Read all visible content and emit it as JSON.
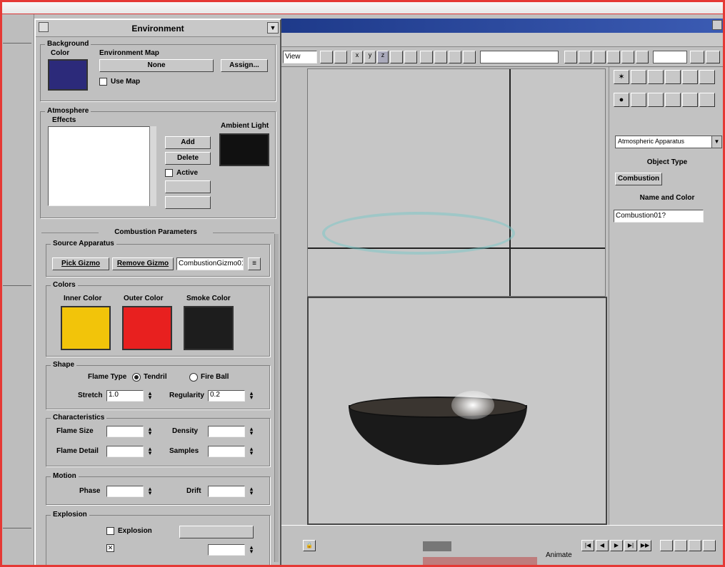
{
  "dialog": {
    "title": "Environment",
    "background": {
      "group": "Background",
      "color_label": "Color",
      "color_value": "#2c2a7a",
      "envmap_label": "Environment Map",
      "envmap_button": "None",
      "assign_button": "Assign...",
      "usemap_label": "Use Map"
    },
    "atmosphere": {
      "group": "Atmosphere",
      "effects_label": "Effects",
      "ambient_label": "Ambient Light",
      "ambient_value": "#111111",
      "add_button": "Add",
      "delete_button": "Delete",
      "active_label": "Active"
    },
    "combustion": {
      "rollout_title": "Combustion Parameters",
      "gizmos_group": "Source Apparatus",
      "pick_button": "Pick Gizmo",
      "remove_button": "Remove Gizmo",
      "gizmo_field": "CombustionGizmo01",
      "colors_group": "Colors",
      "inner_label": "Inner Color",
      "inner_value": "#f2c40a",
      "outer_label": "Outer Color",
      "outer_value": "#e8201f",
      "smoke_label": "Smoke Color",
      "smoke_value": "#1d1d1d",
      "shape_group": "Shape",
      "flame_type_label": "Flame Type",
      "tendril_label": "Tendril",
      "fireball_label": "Fire Ball",
      "stretch_label": "Stretch",
      "stretch_value": "1.0",
      "regularity_label": "Regularity",
      "regularity_value": "0.2",
      "characteristics_group": "Characteristics",
      "flame_size_label": "Flame Size",
      "flame_size_value": "",
      "density_label": "Density",
      "density_value": "",
      "flame_detail_label": "Flame Detail",
      "flame_detail_value": "",
      "samples_label": "Samples",
      "samples_value": "",
      "motion_group": "Motion",
      "phase_label": "Phase",
      "phase_value": "",
      "drift_label": "Drift",
      "drift_value": "",
      "explosion_group": "Explosion",
      "explosion_label": "Explosion"
    }
  },
  "maxwin": {
    "title": "",
    "view_select": "View",
    "command_panel": {
      "dropdown": "Atmospheric Apparatus",
      "object_type_title": "Object Type",
      "object_button": "Combustion",
      "name_color_title": "Name and Color",
      "name_field": "Combustion01?"
    },
    "status": {
      "frame_value": "",
      "time_label": "",
      "sub_label": "",
      "animate_label": "Animate"
    }
  }
}
